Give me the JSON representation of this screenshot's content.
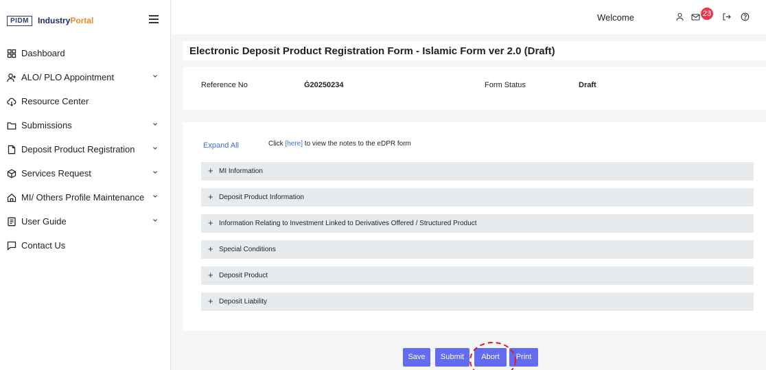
{
  "brand": {
    "logo_box": "PIDM",
    "name_main": "Industry",
    "name_accent": "Portal"
  },
  "sidebar": {
    "items": [
      {
        "label": "Dashboard",
        "icon": "dashboard-icon",
        "chevron": false
      },
      {
        "label": "ALO/ PLO Appointment",
        "icon": "user-add-icon",
        "chevron": true
      },
      {
        "label": "Resource Center",
        "icon": "cloud-download-icon",
        "chevron": false
      },
      {
        "label": "Submissions",
        "icon": "folder-icon",
        "chevron": true
      },
      {
        "label": "Deposit Product Registration",
        "icon": "document-icon",
        "chevron": true
      },
      {
        "label": "Services Request",
        "icon": "cube-icon",
        "chevron": true
      },
      {
        "label": "MI/ Others Profile Maintenance",
        "icon": "home-icon",
        "chevron": true
      },
      {
        "label": "User Guide",
        "icon": "guide-icon",
        "chevron": true
      },
      {
        "label": "Contact Us",
        "icon": "chat-icon",
        "chevron": false
      }
    ]
  },
  "topbar": {
    "welcome": "Welcome",
    "notifications_count": "23"
  },
  "main": {
    "title": "Electronic Deposit Product Registration Form - Islamic Form ver 2.0 (Draft)",
    "reference_label": "Reference No",
    "reference_value": "Ġ20250234",
    "status_label": "Form Status",
    "status_value": "Draft",
    "expand_all": "Expand All",
    "notes_prefix": "Click ",
    "notes_link": "[here]",
    "notes_suffix": " to view the notes to the eDPR form",
    "sections": [
      "MI Information",
      "Deposit Product Information",
      "Information Relating to Investment Linked to Derivatives Offered / Structured Product",
      "Special Conditions",
      "Deposit Product",
      "Deposit Liability"
    ]
  },
  "actions": {
    "save": "Save",
    "submit": "Submit",
    "abort": "Abort",
    "print": "Print"
  },
  "colors": {
    "primary_button": "#636cf0",
    "link": "#3b6fd6",
    "badge": "#f0364d",
    "annotation": "#e01919"
  }
}
